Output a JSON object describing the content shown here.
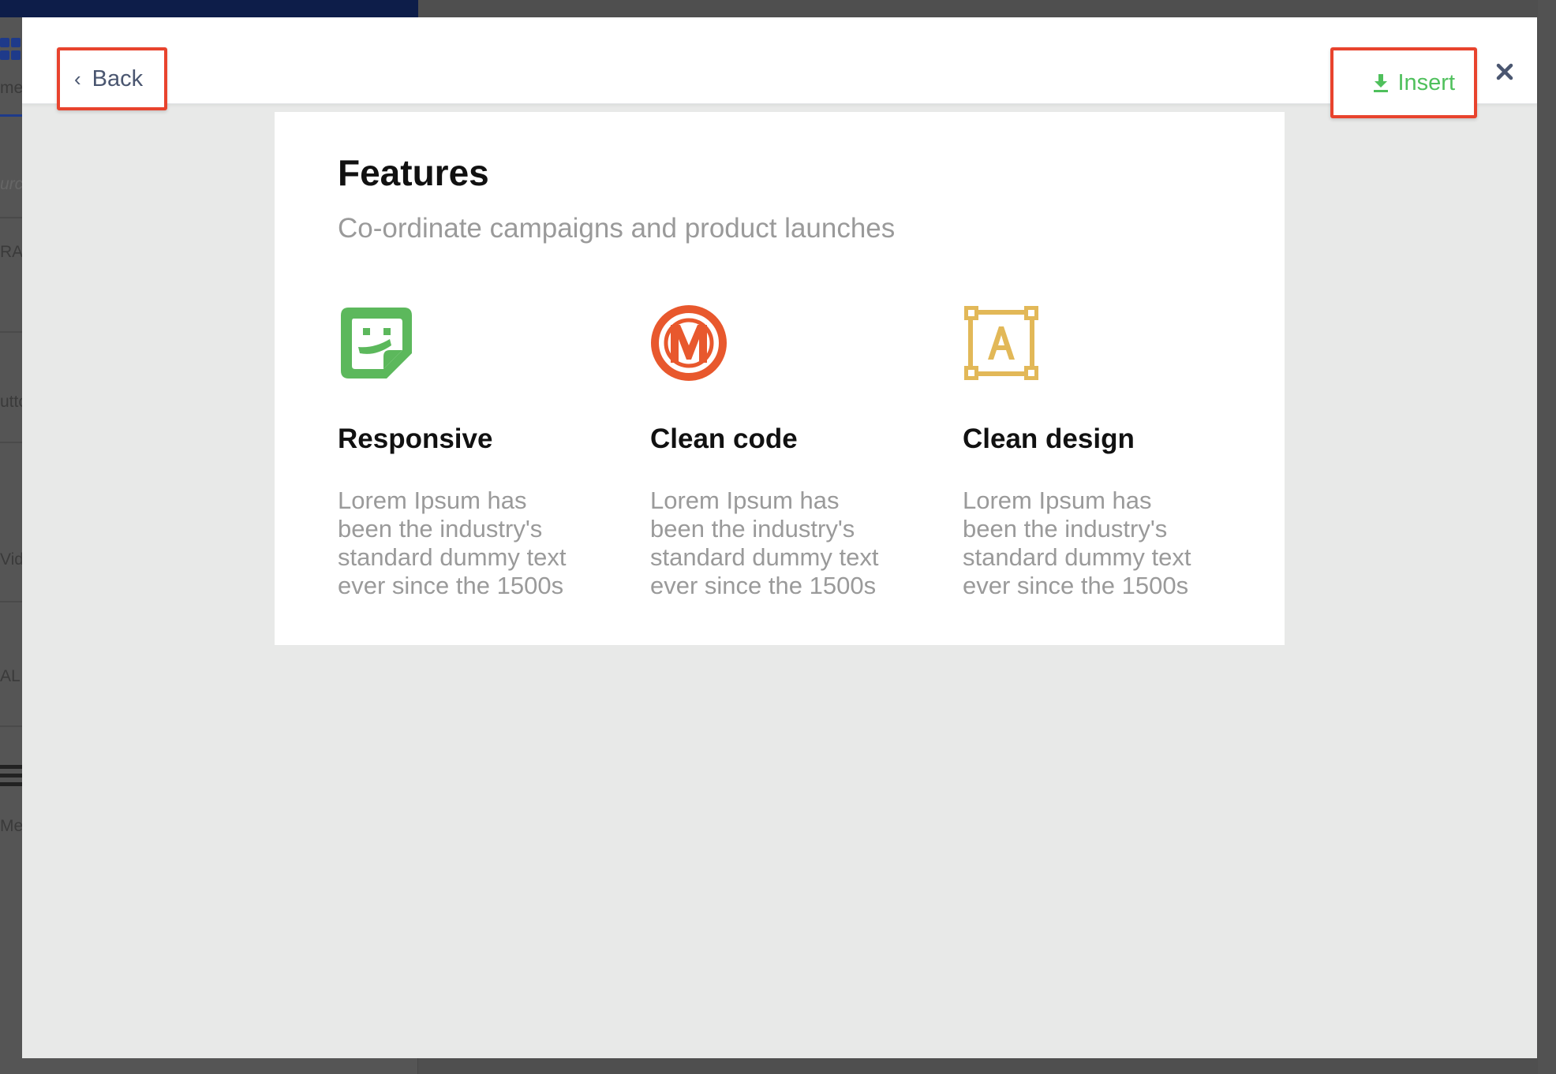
{
  "background_app": {
    "labels": [
      "me",
      "urc",
      "RAL",
      "utto",
      "Vide",
      "AL",
      "Men"
    ]
  },
  "header": {
    "back_label": "Back",
    "back_icon": "chevron-left-icon",
    "insert_label": "Insert",
    "insert_icon": "download-icon",
    "close_icon": "close-icon"
  },
  "colors": {
    "highlight_border": "#e8432d",
    "insert_green": "#4fc05c",
    "feature_green": "#5cb85c",
    "feature_orange": "#e8582d",
    "feature_gold": "#e2b858"
  },
  "preview": {
    "title": "Features",
    "subtitle": "Co-ordinate campaigns and product launches",
    "features": [
      {
        "icon": "smiley-sticker-icon",
        "heading": "Responsive",
        "body": "Lorem Ipsum has been the industry's standard dummy text ever since the 1500s"
      },
      {
        "icon": "metro-m-circle-icon",
        "heading": "Clean code",
        "body": "Lorem Ipsum has been the industry's standard dummy text ever since the 1500s"
      },
      {
        "icon": "text-frame-icon",
        "heading": "Clean design",
        "body": "Lorem Ipsum has been the industry's standard dummy text ever since the 1500s"
      }
    ]
  }
}
